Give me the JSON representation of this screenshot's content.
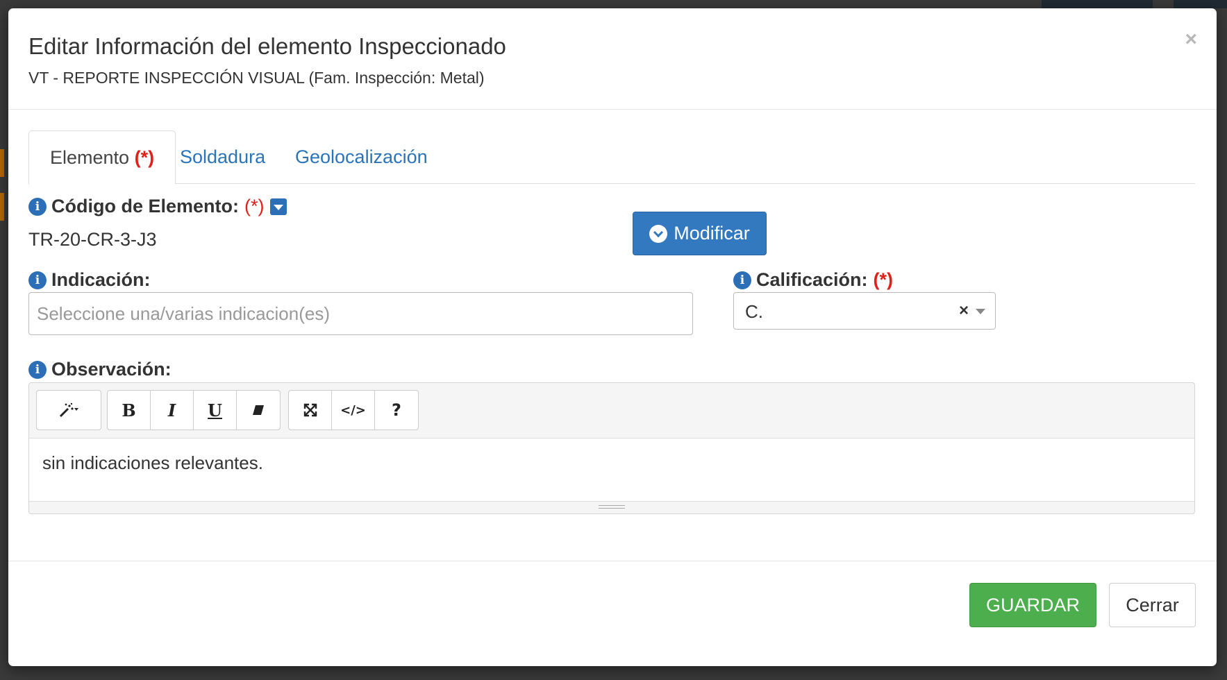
{
  "modal": {
    "title": "Editar Información del elemento Inspeccionado",
    "subtitle": "VT - REPORTE INSPECCIÓN VISUAL (Fam. Inspección: Metal)",
    "close_symbol": "×"
  },
  "tabs": [
    {
      "label": "Elemento",
      "required_mark": "(*)",
      "active": true
    },
    {
      "label": "Soldadura",
      "active": false
    },
    {
      "label": "Geolocalización",
      "active": false
    }
  ],
  "codigo": {
    "label": "Código de Elemento:",
    "required_mark": "(*)",
    "value": "TR-20-CR-3-J3",
    "modify_button": "Modificar"
  },
  "indicacion": {
    "label": "Indicación:",
    "placeholder": "Seleccione una/varias indicacion(es)"
  },
  "calificacion": {
    "label": "Calificación:",
    "required_mark": "(*)",
    "selected": "C.",
    "clear_symbol": "×"
  },
  "observacion": {
    "label": "Observación:",
    "toolbar": {
      "style": "magic-wand-icon",
      "bold": "B",
      "italic": "I",
      "underline": "U",
      "eraser": "eraser-icon",
      "fullscreen": "expand-icon",
      "code": "</>",
      "help": "?"
    },
    "content": "sin indicaciones relevantes."
  },
  "footer": {
    "save_label": "GUARDAR",
    "close_label": "Cerrar"
  },
  "colors": {
    "primary": "#3279c0",
    "success": "#4cae4c",
    "required": "#e0201a",
    "link": "#2a74b8"
  }
}
